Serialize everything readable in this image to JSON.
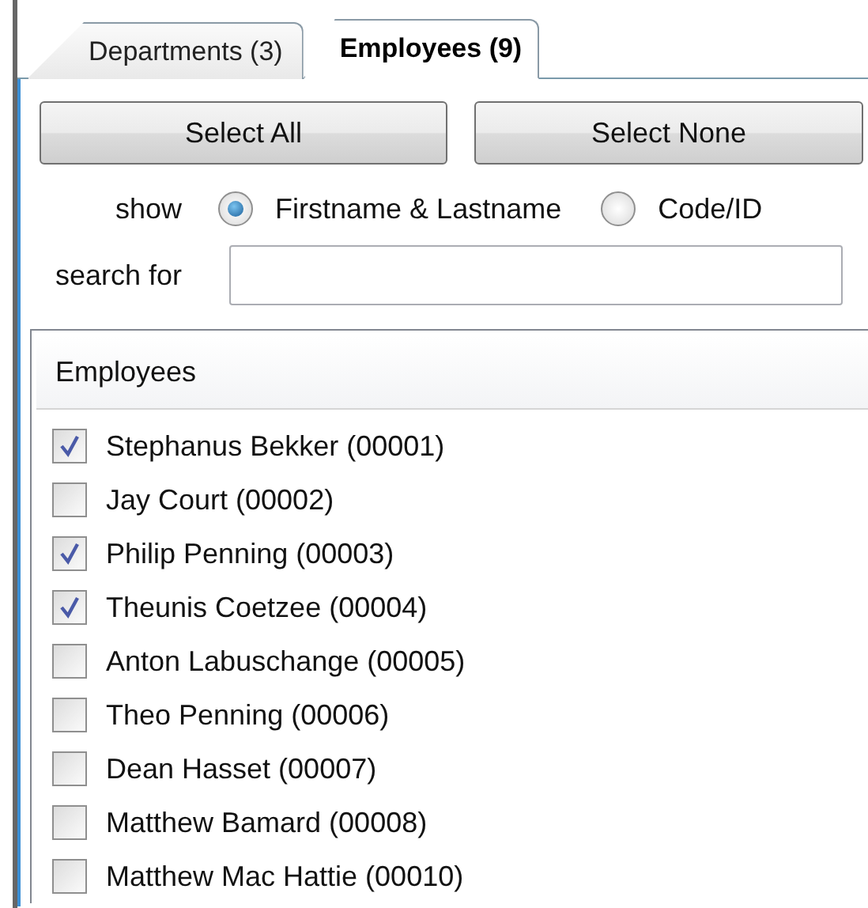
{
  "tabs": [
    {
      "label": "Departments (3)",
      "selected": false
    },
    {
      "label": "Employees (9)",
      "selected": true
    }
  ],
  "buttons": [
    "Select All",
    "Select None"
  ],
  "show": {
    "label": "show",
    "options": [
      {
        "label": "Firstname & Lastname",
        "selected": true
      },
      {
        "label": "Code/ID",
        "selected": false
      }
    ]
  },
  "search": {
    "label": "search for"
  },
  "list": {
    "header": "Employees",
    "items": [
      {
        "label": "Stephanus Bekker (00001)",
        "checked": true
      },
      {
        "label": "Jay Court (00002)",
        "checked": false
      },
      {
        "label": "Philip Penning (00003)",
        "checked": true
      },
      {
        "label": "Theunis Coetzee (00004)",
        "checked": true
      },
      {
        "label": "Anton Labuschange (00005)",
        "checked": false
      },
      {
        "label": "Theo Penning (00006)",
        "checked": false
      },
      {
        "label": "Dean Hasset (00007)",
        "checked": false
      },
      {
        "label": "Matthew Bamard (00008)",
        "checked": false
      },
      {
        "label": "Matthew Mac Hattie (00010)",
        "checked": false
      }
    ]
  }
}
